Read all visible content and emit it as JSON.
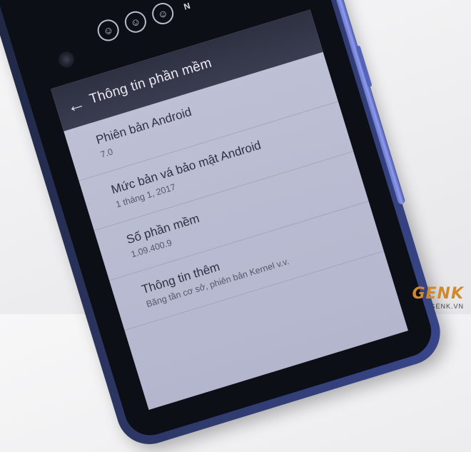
{
  "colors": {
    "app_bar": "#33364a",
    "screen_bg": "#bcbed4",
    "phone_body": "#2b3560",
    "watermark_accent": "#d08a2e"
  },
  "status_icons": [
    "add-person-icon",
    "account-icon",
    "account-icon",
    "nfc-icon"
  ],
  "status": {
    "nfc_label": "N"
  },
  "app_bar": {
    "back_icon": "arrow-left-icon",
    "title": "Thông tin phần mềm"
  },
  "settings_items": [
    {
      "title": "Phiên bản Android",
      "subtitle": "7.0"
    },
    {
      "title": "Mức bản vá bảo mật Android",
      "subtitle": "1 tháng 1, 2017"
    },
    {
      "title": "Số phần mềm",
      "subtitle": "1.09.400.9"
    },
    {
      "title": "Thông tin thêm",
      "subtitle": "Băng tần cơ sở, phiên bản Kernel v.v."
    }
  ],
  "watermark": {
    "logo": "GENK",
    "site": "GENK.VN"
  }
}
